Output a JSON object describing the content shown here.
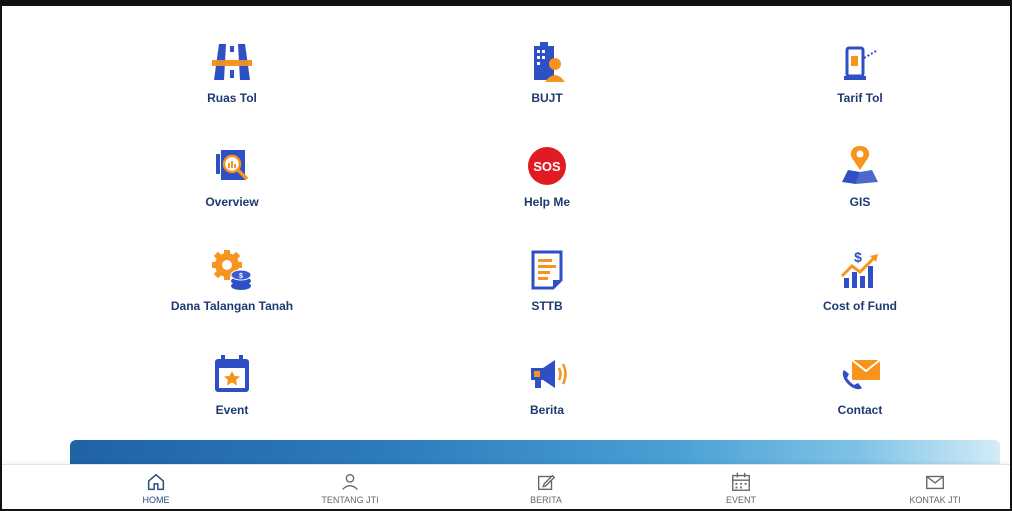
{
  "menu": [
    {
      "label": "Ruas Tol",
      "icon": "highway-icon"
    },
    {
      "label": "BUJT",
      "icon": "building-person-icon"
    },
    {
      "label": "Tarif Tol",
      "icon": "toll-gate-icon"
    },
    {
      "label": "Overview",
      "icon": "document-search-icon"
    },
    {
      "label": "Help Me",
      "icon": "sos-icon"
    },
    {
      "label": "GIS",
      "icon": "map-pin-icon"
    },
    {
      "label": "Dana Talangan Tanah",
      "icon": "gear-coins-icon"
    },
    {
      "label": "STTB",
      "icon": "document-list-icon"
    },
    {
      "label": "Cost of Fund",
      "icon": "dollar-growth-icon"
    },
    {
      "label": "Event",
      "icon": "calendar-star-icon"
    },
    {
      "label": "Berita",
      "icon": "megaphone-icon"
    },
    {
      "label": "Contact",
      "icon": "phone-mail-icon"
    }
  ],
  "bottom_nav": [
    {
      "label": "HOME",
      "icon": "home-icon",
      "active": true
    },
    {
      "label": "TENTANG JTI",
      "icon": "user-icon",
      "active": false
    },
    {
      "label": "BERITA",
      "icon": "edit-icon",
      "active": false
    },
    {
      "label": "EVENT",
      "icon": "calendar-icon",
      "active": false
    },
    {
      "label": "KONTAK JTI",
      "icon": "mail-icon",
      "active": false
    }
  ],
  "colors": {
    "navy": "#1d3a70",
    "icon_blue": "#2f4fc4",
    "icon_orange": "#f7941d",
    "sos_red": "#e11b22"
  }
}
